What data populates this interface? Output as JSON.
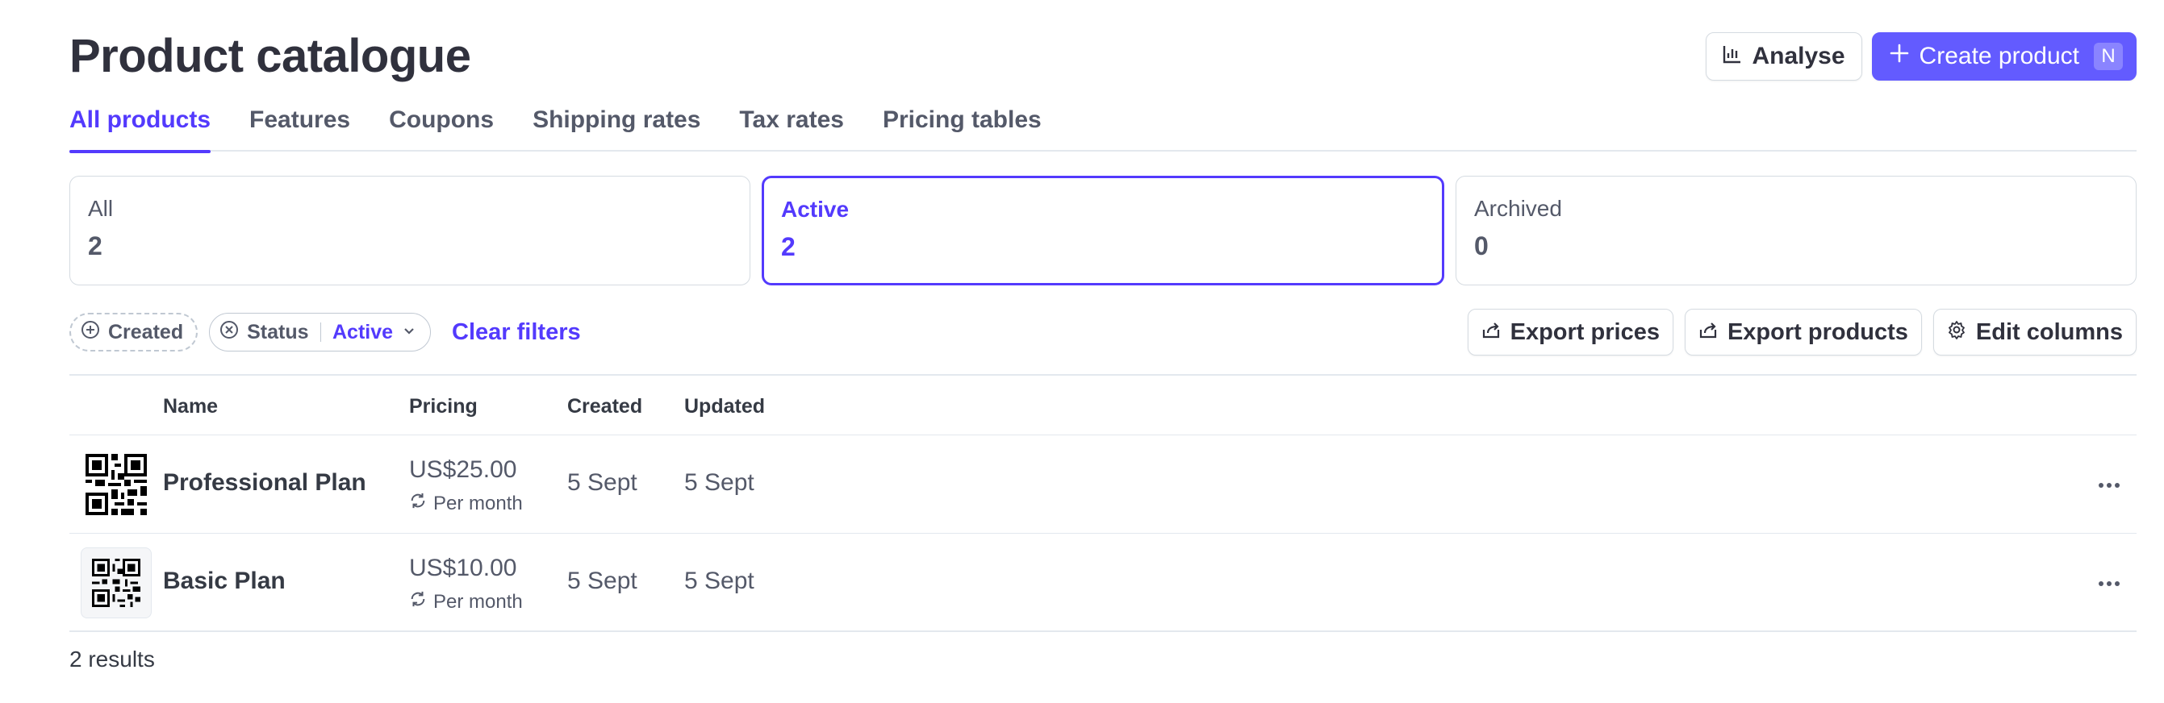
{
  "page": {
    "title": "Product catalogue"
  },
  "actions": {
    "analyse_label": "Analyse",
    "create_label": "Create product",
    "create_shortcut": "N"
  },
  "tabs": [
    {
      "label": "All products",
      "active": true
    },
    {
      "label": "Features"
    },
    {
      "label": "Coupons"
    },
    {
      "label": "Shipping rates"
    },
    {
      "label": "Tax rates"
    },
    {
      "label": "Pricing tables"
    }
  ],
  "status_cards": [
    {
      "label": "All",
      "count": "2"
    },
    {
      "label": "Active",
      "count": "2",
      "selected": true
    },
    {
      "label": "Archived",
      "count": "0"
    }
  ],
  "filters": {
    "created_label": "Created",
    "status_label": "Status",
    "status_value": "Active",
    "clear_label": "Clear filters"
  },
  "table_actions": {
    "export_prices": "Export prices",
    "export_products": "Export products",
    "edit_columns": "Edit columns"
  },
  "table": {
    "columns": [
      "Name",
      "Pricing",
      "Created",
      "Updated"
    ],
    "rows": [
      {
        "name": "Professional Plan",
        "price": "US$25.00",
        "period": "Per month",
        "created": "5 Sept",
        "updated": "5 Sept"
      },
      {
        "name": "Basic Plan",
        "price": "US$10.00",
        "period": "Per month",
        "created": "5 Sept",
        "updated": "5 Sept"
      }
    ]
  },
  "footer": {
    "results": "2 results"
  },
  "colors": {
    "accent": "#533afd",
    "primary_button": "#635bff",
    "border": "#d5dbe1",
    "text": "#353a44"
  },
  "icons": [
    "chart-icon",
    "plus-icon",
    "add-circle-icon",
    "clear-circle-icon",
    "chevron-down-icon",
    "export-icon",
    "gear-icon",
    "recurring-icon",
    "qr-code-icon",
    "more-icon"
  ]
}
